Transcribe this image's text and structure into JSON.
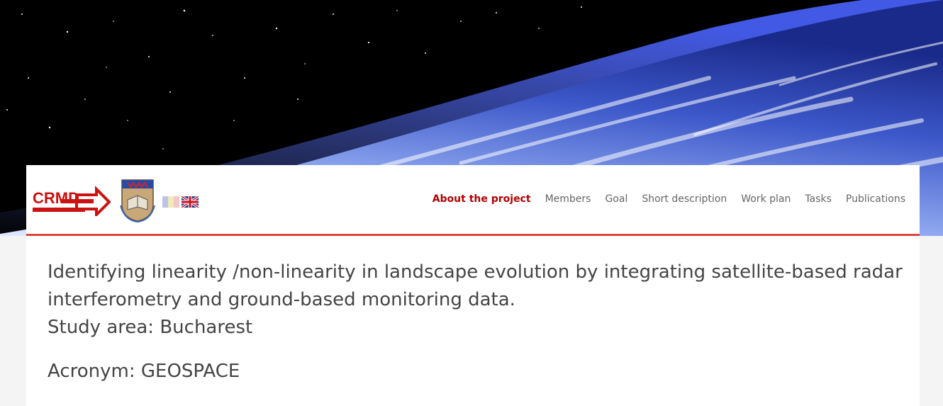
{
  "logos": {
    "crmd_text": "CRMD"
  },
  "nav": {
    "items": [
      {
        "label": "About the project",
        "active": true
      },
      {
        "label": "Members",
        "active": false
      },
      {
        "label": "Goal",
        "active": false
      },
      {
        "label": "Short description",
        "active": false
      },
      {
        "label": "Work plan",
        "active": false
      },
      {
        "label": "Tasks",
        "active": false
      },
      {
        "label": "Publications",
        "active": false
      }
    ]
  },
  "content": {
    "title": "Identifying linearity /non-linearity in landscape evolution by integrating satellite-based radar interferometry and ground-based monitoring data.",
    "study_area": "Study area: Bucharest",
    "acronym": "Acronym: GEOSPACE"
  },
  "colors": {
    "accent": "#d9453f",
    "active_nav": "#b30000",
    "nav_text": "#666666",
    "body_text": "#444444"
  }
}
